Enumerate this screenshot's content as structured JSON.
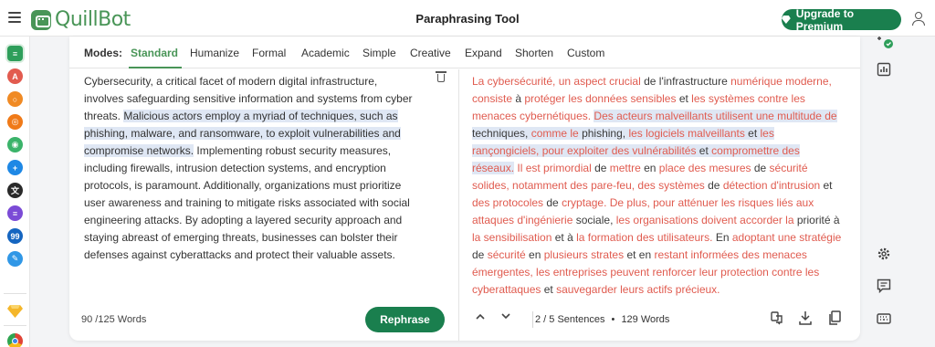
{
  "header": {
    "app_name": "QuillBot",
    "title": "Paraphrasing Tool",
    "premium_label": "Upgrade to Premium"
  },
  "modes": {
    "label": "Modes:",
    "items": [
      "Standard",
      "Humanize",
      "Formal",
      "Academic",
      "Simple",
      "Creative",
      "Expand",
      "Shorten",
      "Custom"
    ],
    "active": "Standard"
  },
  "input": {
    "p1": "Cybersecurity, a critical facet of modern digital infrastructure, involves safeguarding sensitive information and systems from cyber threats.",
    "p2_highlight": "Malicious actors employ a myriad of techniques, such as phishing, malware, and ransomware, to exploit vulnerabilities and compromise networks.",
    "p3": "Implementing robust security measures, including firewalls, intrusion detection systems, and encryption protocols, is paramount. Additionally, organizations must prioritize user awareness and training to mitigate risks associated with social engineering attacks. By adopting a layered security approach and staying abreast of emerging threats, businesses can bolster their defenses against cyberattacks and protect their valuable assets.",
    "word_count": "90 /125 Words"
  },
  "output": {
    "s1": [
      {
        "t": "La cybersécurité, un aspect crucial",
        "c": 1
      },
      {
        "t": " de l'infrastructure ",
        "c": 0
      },
      {
        "t": "numérique moderne, consiste",
        "c": 1
      },
      {
        "t": " à ",
        "c": 0
      },
      {
        "t": "protéger les données sensibles",
        "c": 1
      },
      {
        "t": " et ",
        "c": 0
      },
      {
        "t": "les systèmes contre les menaces cybernétiques.",
        "c": 1
      },
      {
        "t": " ",
        "c": 0
      }
    ],
    "s2": [
      {
        "t": "Des acteurs malveillants utilisent une multitude de",
        "c": 1
      },
      {
        "t": " techniques, ",
        "c": 0
      },
      {
        "t": "comme le",
        "c": 1
      },
      {
        "t": " phishing, ",
        "c": 0
      },
      {
        "t": "les logiciels malveillants",
        "c": 1
      },
      {
        "t": " et ",
        "c": 0
      },
      {
        "t": "les rançongiciels, pour exploiter des vulnérabilités",
        "c": 1
      },
      {
        "t": " et ",
        "c": 0
      },
      {
        "t": "compromettre des réseaux.",
        "c": 1
      }
    ],
    "s3": [
      {
        "t": " ",
        "c": 0
      },
      {
        "t": "Il est primordial",
        "c": 1
      },
      {
        "t": " de ",
        "c": 0
      },
      {
        "t": "mettre",
        "c": 1
      },
      {
        "t": " en ",
        "c": 0
      },
      {
        "t": "place des mesures",
        "c": 1
      },
      {
        "t": " de ",
        "c": 0
      },
      {
        "t": "sécurité solides, notamment des pare-feu, des systèmes",
        "c": 1
      },
      {
        "t": " de ",
        "c": 0
      },
      {
        "t": "détection d'intrusion",
        "c": 1
      },
      {
        "t": " et ",
        "c": 0
      },
      {
        "t": "des protocoles",
        "c": 1
      },
      {
        "t": " de ",
        "c": 0
      },
      {
        "t": "cryptage. De plus, pour atténuer les risques liés aux attaques d'ingénierie",
        "c": 1
      },
      {
        "t": " sociale, ",
        "c": 0
      },
      {
        "t": "les organisations doivent accorder la",
        "c": 1
      },
      {
        "t": " priorité ",
        "c": 0
      },
      {
        "t": "à",
        "c": 0
      },
      {
        "t": " ",
        "c": 0
      },
      {
        "t": "la sensibilisation",
        "c": 1
      },
      {
        "t": " et ",
        "c": 0
      },
      {
        "t": "à",
        "c": 0
      },
      {
        "t": " ",
        "c": 0
      },
      {
        "t": "la formation des utilisateurs.",
        "c": 1
      },
      {
        "t": " En ",
        "c": 0
      },
      {
        "t": "adoptant une stratégie",
        "c": 1
      },
      {
        "t": " de ",
        "c": 0
      },
      {
        "t": "sécurité",
        "c": 1
      },
      {
        "t": " en ",
        "c": 0
      },
      {
        "t": "plusieurs strates",
        "c": 1
      },
      {
        "t": " et en ",
        "c": 0
      },
      {
        "t": "restant informées des menaces émergentes, les entreprises peuvent renforcer leur protection contre les cyberattaques",
        "c": 1
      },
      {
        "t": " et ",
        "c": 0
      },
      {
        "t": "sauvegarder leurs actifs précieux.",
        "c": 1
      }
    ],
    "sentences": "2 / 5 Sentences",
    "bullet": "•",
    "word_count": "129 Words"
  },
  "rephrase_label": "Rephrase",
  "colors": {
    "brand": "#499557",
    "button": "#1a7f4e",
    "changed": "#e05b4f",
    "highlight": "#dfe7f4"
  },
  "rail_icons": [
    {
      "name": "paraphraser-icon",
      "color": "#2e9e5a"
    },
    {
      "name": "grammar-checker-icon",
      "color": "#e25b4f"
    },
    {
      "name": "ai-detector-icon",
      "color": "#f08a24"
    },
    {
      "name": "plagiarism-checker-icon",
      "color": "#f07a18"
    },
    {
      "name": "humanizer-icon",
      "color": "#3bb36a"
    },
    {
      "name": "chat-icon",
      "color": "#1e88e5"
    },
    {
      "name": "translator-icon",
      "color": "#2a2a2a"
    },
    {
      "name": "summarizer-icon",
      "color": "#7b4bd6"
    },
    {
      "name": "citation-generator-icon",
      "color": "#1565c0"
    },
    {
      "name": "flow-icon",
      "color": "#3097e6"
    }
  ]
}
